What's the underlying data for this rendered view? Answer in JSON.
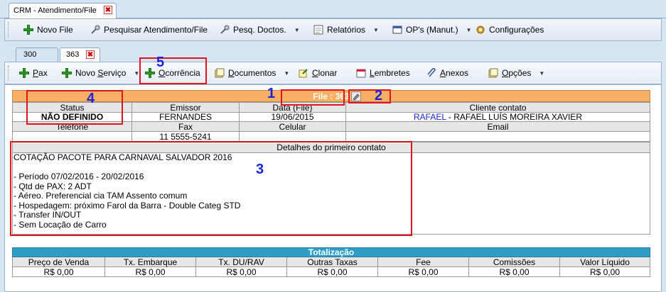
{
  "outer_tab": {
    "title": "CRM - Atendimento/File",
    "close": "✖"
  },
  "top_toolbar": {
    "novo_file": "Novo File",
    "pesquisar": "Pesquisar Atendimento/File",
    "pesq_doctos": "Pesq. Doctos.",
    "relatorios": "Relatórios",
    "ops": "OP's (Manut.)",
    "configuracoes": "Configurações"
  },
  "inner_tabs": [
    {
      "label": "300"
    },
    {
      "label": "363",
      "close": "✖"
    }
  ],
  "inner_toolbar": {
    "pax": {
      "underline": "P",
      "rest": "ax"
    },
    "novo_servico": {
      "before": "Novo ",
      "underline": "S",
      "rest": "erviço"
    },
    "ocorrencia": {
      "underline": "O",
      "rest": "corrência"
    },
    "documentos": {
      "underline": "D",
      "rest": "ocumentos"
    },
    "clonar": {
      "underline": "C",
      "rest": "lonar"
    },
    "lembretes": {
      "underline": "L",
      "rest": "embretes"
    },
    "anexos": {
      "underline": "A",
      "rest": "nexos"
    },
    "opcoes": {
      "underline": "O",
      "rest": "pções"
    }
  },
  "file_header": "File : 363",
  "info_table": {
    "headers1": [
      "Status",
      "Emissor",
      "Data (File)",
      "Cliente contato"
    ],
    "status": "NÃO DEFINIDO",
    "emissor": "FERNANDES",
    "data": "19/06/2015",
    "cliente_link": "RAFAEL",
    "cliente_rest": " - RAFAEL LUÍS MOREIRA XAVIER",
    "headers2": [
      "Telefone",
      "Fax",
      "Celular",
      "Email"
    ],
    "fax": "11 5555-5241"
  },
  "detalhes": {
    "header": "Detalhes do primeiro contato",
    "lines": [
      "COTAÇÃO PACOTE PARA CARNAVAL SALVADOR 2016",
      "",
      "- Período 07/02/2016 - 20/02/2016",
      "- Qtd de PAX: 2 ADT",
      "- Aéreo. Preferencial cia TAM Assento comum",
      "- Hospedagem: próximo Farol da Barra - Double Categ STD",
      "- Transfer IN/OUT",
      "- Sem Locação de Carro"
    ]
  },
  "totalizacao": {
    "title": "Totalização",
    "headers": [
      "Preço de Venda",
      "Tx. Embarque",
      "Tx. DU/RAV",
      "Outras Taxas",
      "Fee",
      "Comissões",
      "Valor Líquido"
    ],
    "values": [
      "R$ 0,00",
      "R$ 0,00",
      "R$ 0,00",
      "R$ 0,00",
      "R$ 0,00",
      "R$ 0,00",
      "R$ 0,00"
    ]
  },
  "annotations": [
    "1",
    "2",
    "3",
    "4",
    "5"
  ],
  "colors": {
    "annotation_box": "#e0141e",
    "annotation_number": "#1a25d8",
    "file_header_bg": "#f7b063",
    "totalizacao_bg": "#2f9ec6",
    "link": "#1a25d8"
  }
}
